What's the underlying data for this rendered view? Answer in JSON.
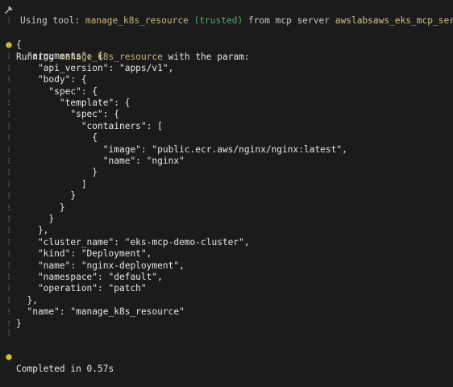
{
  "header": {
    "prefix": "Using tool:",
    "tool_name": "manage_k8s_resource",
    "trusted_label": "(trusted)",
    "from_text": "from mcp server",
    "server_name": "awslabsaws_eks_mcp_server"
  },
  "running": {
    "prefix": "Running",
    "tool_name": "manage_k8s_resource",
    "suffix": "with the param:"
  },
  "params_lines": [
    "{",
    "  \"arguments\": {",
    "    \"api_version\": \"apps/v1\",",
    "    \"body\": {",
    "      \"spec\": {",
    "        \"template\": {",
    "          \"spec\": {",
    "            \"containers\": [",
    "              {",
    "                \"image\": \"public.ecr.aws/nginx/nginx:latest\",",
    "                \"name\": \"nginx\"",
    "              }",
    "            ]",
    "          }",
    "        }",
    "      }",
    "    },",
    "    \"cluster_name\": \"eks-mcp-demo-cluster\",",
    "    \"kind\": \"Deployment\",",
    "    \"name\": \"nginx-deployment\",",
    "    \"namespace\": \"default\",",
    "    \"operation\": \"patch\"",
    "  },",
    "  \"name\": \"manage_k8s_resource\"",
    "}"
  ],
  "completed": "Completed in 0.57s",
  "colors": {
    "background": "#1b1b1b",
    "tool_name": "#c6b679",
    "trusted": "#4fae67",
    "bullet": "#d2c62b"
  }
}
